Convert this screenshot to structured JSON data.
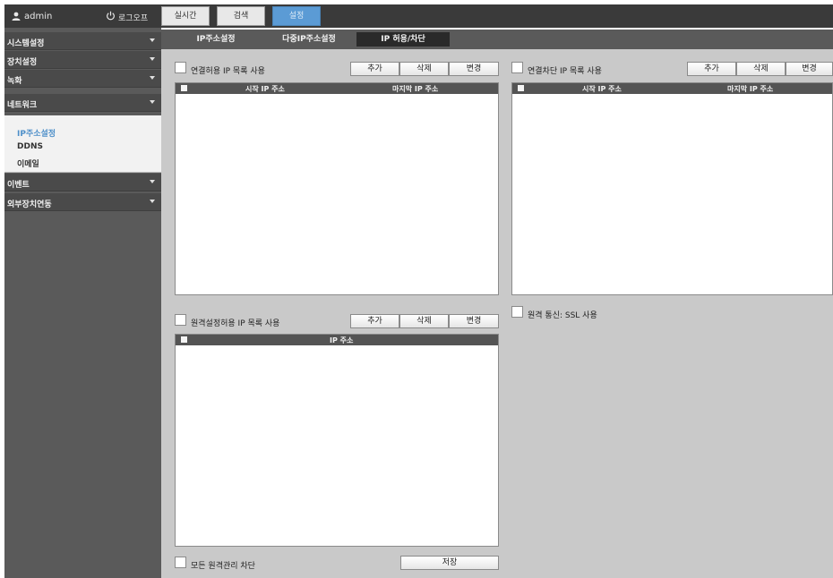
{
  "user": {
    "name": "admin",
    "icon": "user-icon",
    "logout_label": "로그오프",
    "logout_icon": "power-icon"
  },
  "main_tabs": [
    {
      "label": "실시간",
      "active": false
    },
    {
      "label": "검색",
      "active": false
    },
    {
      "label": "설정",
      "active": true
    }
  ],
  "sidebar": {
    "menus": [
      {
        "label": "시스템설정"
      },
      {
        "label": "장치설정"
      },
      {
        "label": "녹화"
      },
      {
        "label": "네트워크"
      },
      {
        "label": "이벤트"
      },
      {
        "label": "외부장치연동"
      }
    ],
    "network_submenu": [
      {
        "label": "IP주소설정",
        "active": true
      },
      {
        "label": "DDNS",
        "active": false
      },
      {
        "label": "이메일",
        "active": false
      }
    ]
  },
  "sub_tabs": [
    {
      "label": "IP주소설정",
      "active": false
    },
    {
      "label": "다중IP주소설정",
      "active": false
    },
    {
      "label": "IP 허용/차단",
      "active": true
    }
  ],
  "allow_list": {
    "checkbox_label": "연결허용 IP 목록 사용",
    "checked": false,
    "buttons": {
      "add": "추가",
      "delete": "삭제",
      "change": "변경"
    },
    "columns": {
      "start": "시작 IP 주소",
      "end": "마지막 IP 주소"
    },
    "rows": []
  },
  "block_list": {
    "checkbox_label": "연결차단 IP 목록 사용",
    "checked": false,
    "buttons": {
      "add": "추가",
      "delete": "삭제",
      "change": "변경"
    },
    "columns": {
      "start": "시작 IP 주소",
      "end": "마지막 IP 주소"
    },
    "rows": []
  },
  "remote_list": {
    "checkbox_label": "원격설정허용 IP 목록 사용",
    "checked": false,
    "buttons": {
      "add": "추가",
      "delete": "삭제",
      "change": "변경"
    },
    "columns": {
      "ip": "IP 주소"
    },
    "rows": []
  },
  "ssl": {
    "label": "원격 통신: SSL 사용",
    "checked": false
  },
  "block_all_remote": {
    "label": "모든 원격관리 차단",
    "checked": false
  },
  "save_label": "저장",
  "colors": {
    "active_tab": "#5b9bd5",
    "active_submenu_text": "#4d8fc9",
    "panel_bg": "#c9c9c9",
    "sidebar_bg": "#5a5a5a"
  }
}
